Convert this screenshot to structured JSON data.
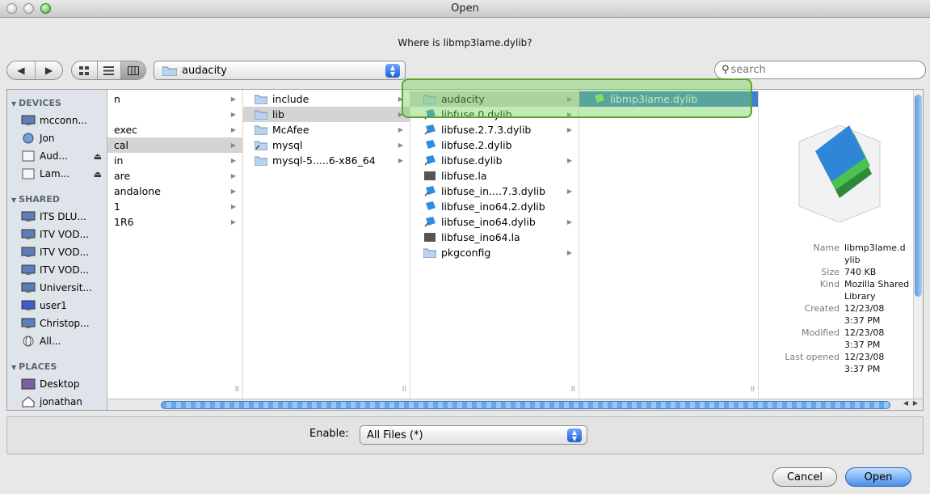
{
  "window": {
    "title": "Open"
  },
  "prompt": "Where is libmp3lame.dylib?",
  "toolbar": {
    "path": "audacity",
    "search_placeholder": "search"
  },
  "sidebar": {
    "devices_header": "DEVICES",
    "devices": [
      "mcconn...",
      "Jon",
      "Aud...",
      "Lam..."
    ],
    "shared_header": "SHARED",
    "shared": [
      "ITS DLU...",
      "ITV VOD...",
      "ITV VOD...",
      "ITV VOD...",
      "Universit...",
      "user1",
      "Christop...",
      "All..."
    ],
    "places_header": "PLACES",
    "places": [
      "Desktop",
      "jonathan"
    ]
  },
  "columns": {
    "col1": [
      "n",
      "",
      "exec",
      "cal",
      "in",
      "are",
      "andalone",
      "1",
      "1R6"
    ],
    "col2": [
      "include",
      "lib",
      "McAfee",
      "mysql",
      "mysql-5.....6-x86_64"
    ],
    "col3": [
      "audacity",
      "libfuse.0.dylib",
      "libfuse.2.7.3.dylib",
      "libfuse.2.dylib",
      "libfuse.dylib",
      "libfuse.la",
      "libfuse_in....7.3.dylib",
      "libfuse_ino64.2.dylib",
      "libfuse_ino64.dylib",
      "libfuse_ino64.la",
      "pkgconfig"
    ],
    "col4": [
      "libmp3lame.dylib"
    ]
  },
  "preview": {
    "name_key": "Name",
    "name_val1": "libmp3lame.d",
    "name_val2": "ylib",
    "size_key": "Size",
    "size_val": "740 KB",
    "kind_key": "Kind",
    "kind_val1": "Mozilla Shared",
    "kind_val2": "Library",
    "created_key": "Created",
    "created_date": "12/23/08",
    "created_time": "3:37 PM",
    "modified_key": "Modified",
    "modified_date": "12/23/08",
    "modified_time": "3:37 PM",
    "opened_key": "Last opened",
    "opened_date": "12/23/08",
    "opened_time": "3:37 PM"
  },
  "enable": {
    "label": "Enable:",
    "value": "All Files (*)"
  },
  "buttons": {
    "cancel": "Cancel",
    "open": "Open"
  }
}
